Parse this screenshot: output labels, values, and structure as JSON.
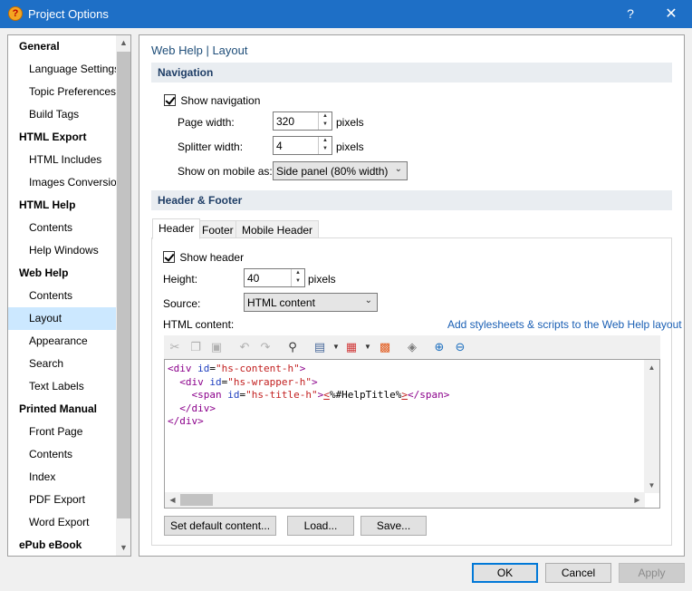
{
  "window": {
    "title": "Project Options",
    "help": "?",
    "close": "✕"
  },
  "sidebar": {
    "items": [
      {
        "label": "General",
        "type": "group"
      },
      {
        "label": "Language Settings",
        "type": "item"
      },
      {
        "label": "Topic Preferences",
        "type": "item"
      },
      {
        "label": "Build Tags",
        "type": "item"
      },
      {
        "label": "HTML Export",
        "type": "group"
      },
      {
        "label": "HTML Includes",
        "type": "item"
      },
      {
        "label": "Images Conversion",
        "type": "item"
      },
      {
        "label": "HTML Help",
        "type": "group"
      },
      {
        "label": "Contents",
        "type": "item"
      },
      {
        "label": "Help Windows",
        "type": "item"
      },
      {
        "label": "Web Help",
        "type": "group"
      },
      {
        "label": "Contents",
        "type": "item"
      },
      {
        "label": "Layout",
        "type": "item",
        "selected": true
      },
      {
        "label": "Appearance",
        "type": "item"
      },
      {
        "label": "Search",
        "type": "item"
      },
      {
        "label": "Text Labels",
        "type": "item"
      },
      {
        "label": "Printed Manual",
        "type": "group"
      },
      {
        "label": "Front Page",
        "type": "item"
      },
      {
        "label": "Contents",
        "type": "item"
      },
      {
        "label": "Index",
        "type": "item"
      },
      {
        "label": "PDF Export",
        "type": "item"
      },
      {
        "label": "Word Export",
        "type": "item"
      },
      {
        "label": "ePub eBook",
        "type": "group"
      }
    ]
  },
  "main": {
    "title": "Web Help | Layout",
    "navigation": {
      "header": "Navigation",
      "show_navigation": "Show navigation",
      "page_width_label": "Page width:",
      "page_width_value": "320",
      "page_width_unit": "pixels",
      "splitter_width_label": "Splitter width:",
      "splitter_width_value": "4",
      "splitter_width_unit": "pixels",
      "show_on_mobile_label": "Show on mobile as:",
      "show_on_mobile_value": "Side panel (80% width)"
    },
    "header_footer": {
      "header": "Header & Footer",
      "tabs": [
        "Header",
        "Footer",
        "Mobile Header"
      ],
      "show_header": "Show header",
      "height_label": "Height:",
      "height_value": "40",
      "height_unit": "pixels",
      "source_label": "Source:",
      "source_value": "HTML content",
      "html_content_label": "HTML content:",
      "add_link": "Add stylesheets & scripts to the Web Help layout",
      "buttons": {
        "set_default": "Set default content...",
        "load": "Load...",
        "save": "Save..."
      }
    }
  },
  "footer": {
    "ok": "OK",
    "cancel": "Cancel",
    "apply": "Apply"
  }
}
